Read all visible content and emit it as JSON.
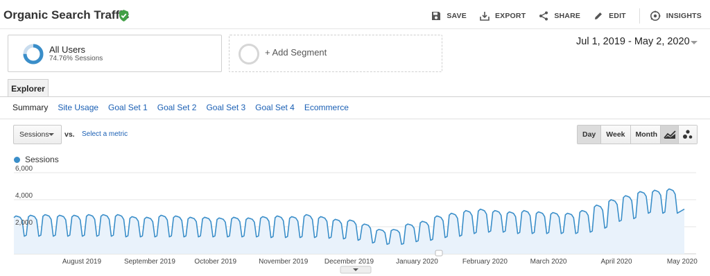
{
  "header": {
    "title": "Organic Search Traffic",
    "verified_icon": "shield-check-icon",
    "actions": [
      {
        "label": "SAVE",
        "icon": "save-icon"
      },
      {
        "label": "EXPORT",
        "icon": "export-icon"
      },
      {
        "label": "SHARE",
        "icon": "share-icon"
      },
      {
        "label": "EDIT",
        "icon": "pencil-icon"
      },
      {
        "label": "INSIGHTS",
        "icon": "insights-icon"
      }
    ]
  },
  "segments": {
    "active": {
      "name": "All Users",
      "detail": "74.76% Sessions",
      "share": 0.7476
    },
    "add_label": "+ Add Segment"
  },
  "date_range": "Jul 1, 2019 - May 2, 2020",
  "tabs": {
    "explorer": "Explorer"
  },
  "subtabs": [
    "Summary",
    "Site Usage",
    "Goal Set 1",
    "Goal Set 2",
    "Goal Set 3",
    "Goal Set 4",
    "Ecommerce"
  ],
  "controls": {
    "metric": "Sessions",
    "vs": "vs.",
    "select_metric": "Select a metric",
    "granularity": [
      "Day",
      "Week",
      "Month"
    ],
    "selected_granularity": "Day",
    "chart_types": [
      "line-chart-icon",
      "motion-chart-icon"
    ]
  },
  "colors": {
    "accent": "#3a8ec9",
    "fill": "#e9f2fb",
    "link": "#1a5fb4"
  },
  "chart_data": {
    "type": "area",
    "series": [
      {
        "name": "Sessions"
      }
    ],
    "y_ticks": [
      "6,000",
      "4,000",
      "2,000"
    ],
    "ylim": [
      0,
      6000
    ],
    "x_labels": [
      "August 2019",
      "September 2019",
      "October 2019",
      "November 2019",
      "December 2019",
      "January 2020",
      "February 2020",
      "March 2020",
      "April 2020",
      "May 2020"
    ],
    "x_range": [
      "2019-07-01",
      "2020-05-02"
    ],
    "weekly_peaks": [
      2800,
      2850,
      2900,
      2850,
      2850,
      2900,
      2900,
      2900,
      2750,
      2700,
      2850,
      2800,
      2700,
      2700,
      2650,
      2700,
      2650,
      2750,
      2800,
      2750,
      2900,
      2750,
      2550,
      2500,
      2200,
      1800,
      1800,
      2200,
      2400,
      2800,
      3000,
      3200,
      3300,
      3200,
      3100,
      3200,
      3100,
      3050,
      3000,
      3200,
      3600,
      4000,
      4300,
      4600,
      4700,
      4800
    ],
    "weekly_troughs": [
      1300,
      1300,
      1300,
      1300,
      1300,
      1300,
      1300,
      1250,
      1250,
      1250,
      1250,
      1250,
      1250,
      1250,
      1250,
      1250,
      1250,
      1200,
      1200,
      1200,
      1200,
      1150,
      1100,
      1000,
      800,
      700,
      700,
      900,
      1000,
      1200,
      1300,
      1500,
      1600,
      1600,
      1500,
      1500,
      1500,
      1500,
      1500,
      1600,
      1900,
      2400,
      2600,
      3000,
      3000,
      3000
    ],
    "last_value": 3300,
    "grid": true
  }
}
